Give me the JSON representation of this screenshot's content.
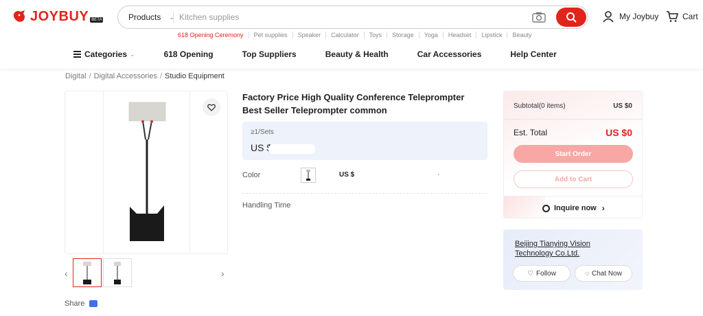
{
  "header": {
    "logo_text": "JOYBUY",
    "logo_badge": "BETA",
    "search": {
      "category": "Products",
      "placeholder": "Kitchen supplies"
    },
    "hot_searches": [
      "618 Opening Ceremony",
      "Pet supplies",
      "Speaker",
      "Calculator",
      "Toys",
      "Storage",
      "Yoga",
      "Headset",
      "Lipstick",
      "Beauty"
    ],
    "account_label": "My Joybuy",
    "cart_label": "Cart",
    "brand_color": "#e1251b"
  },
  "nav": {
    "items": [
      "Categories",
      "618 Opening",
      "Top Suppliers",
      "Beauty & Health",
      "Car Accessories",
      "Help Center"
    ]
  },
  "breadcrumb": [
    "Digital",
    "Digital Accessories",
    "Studio Equipment"
  ],
  "product": {
    "title": "Factory Price High Quality Conference Teleprompter Best Seller Teleprompter common",
    "moq": "≥1/Sets",
    "price_currency": "US $",
    "color_label": "Color",
    "color_price": "US $",
    "handling_label": "Handling Time",
    "share_label": "Share"
  },
  "order": {
    "subtotal_label": "Subtotal(0 items)",
    "subtotal_value": "US $0",
    "est_total_label": "Est. Total",
    "est_total_value": "US $0",
    "start_order": "Start Order",
    "add_to_cart": "Add to Cart",
    "inquire": "Inquire now"
  },
  "supplier": {
    "name": "Beijing Tianying Vision Technology Co.Ltd.",
    "follow": "Follow",
    "chat": "Chat Now"
  }
}
